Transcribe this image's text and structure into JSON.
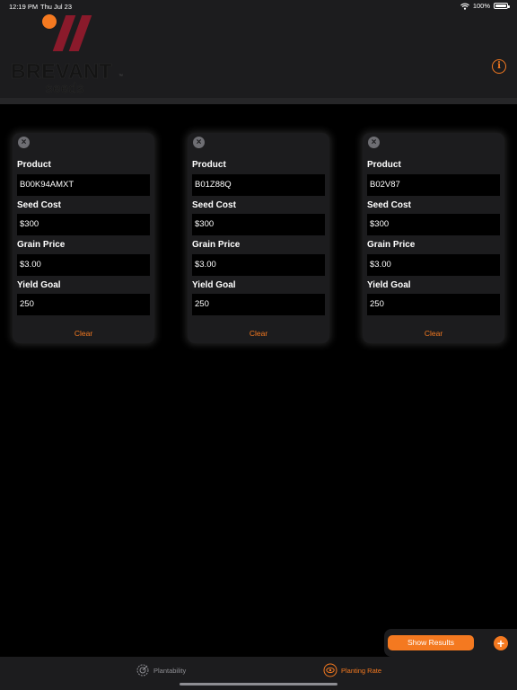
{
  "status_bar": {
    "time": "12:19 PM",
    "date": "Thu Jul 23",
    "battery": "100%"
  },
  "header": {
    "logo": {
      "brand": "BREVANT",
      "tm": "™",
      "sub": "seeds"
    },
    "info_icon": "info-icon"
  },
  "labels": {
    "product": "Product",
    "seed_cost": "Seed Cost",
    "grain_price": "Grain Price",
    "yield_goal": "Yield Goal",
    "clear": "Clear"
  },
  "cards": [
    {
      "product": "B00K94AMXT",
      "seed_cost": "$300",
      "grain_price": "$3.00",
      "yield_goal": "250"
    },
    {
      "product": "B01Z88Q",
      "seed_cost": "$300",
      "grain_price": "$3.00",
      "yield_goal": "250"
    },
    {
      "product": "B02V87",
      "seed_cost": "$300",
      "grain_price": "$3.00",
      "yield_goal": "250"
    }
  ],
  "actions": {
    "show_results": "Show Results",
    "add_icon": "plus-icon"
  },
  "tabs": [
    {
      "label": "Plantability",
      "icon": "plantability-icon",
      "active": false
    },
    {
      "label": "Planting Rate",
      "icon": "planting-rate-icon",
      "active": true
    }
  ],
  "colors": {
    "accent": "#f47920",
    "brand_red": "#8a1a2b",
    "surface": "#1c1c1e",
    "background": "#000000",
    "inactive_tab": "#8e8e93"
  }
}
